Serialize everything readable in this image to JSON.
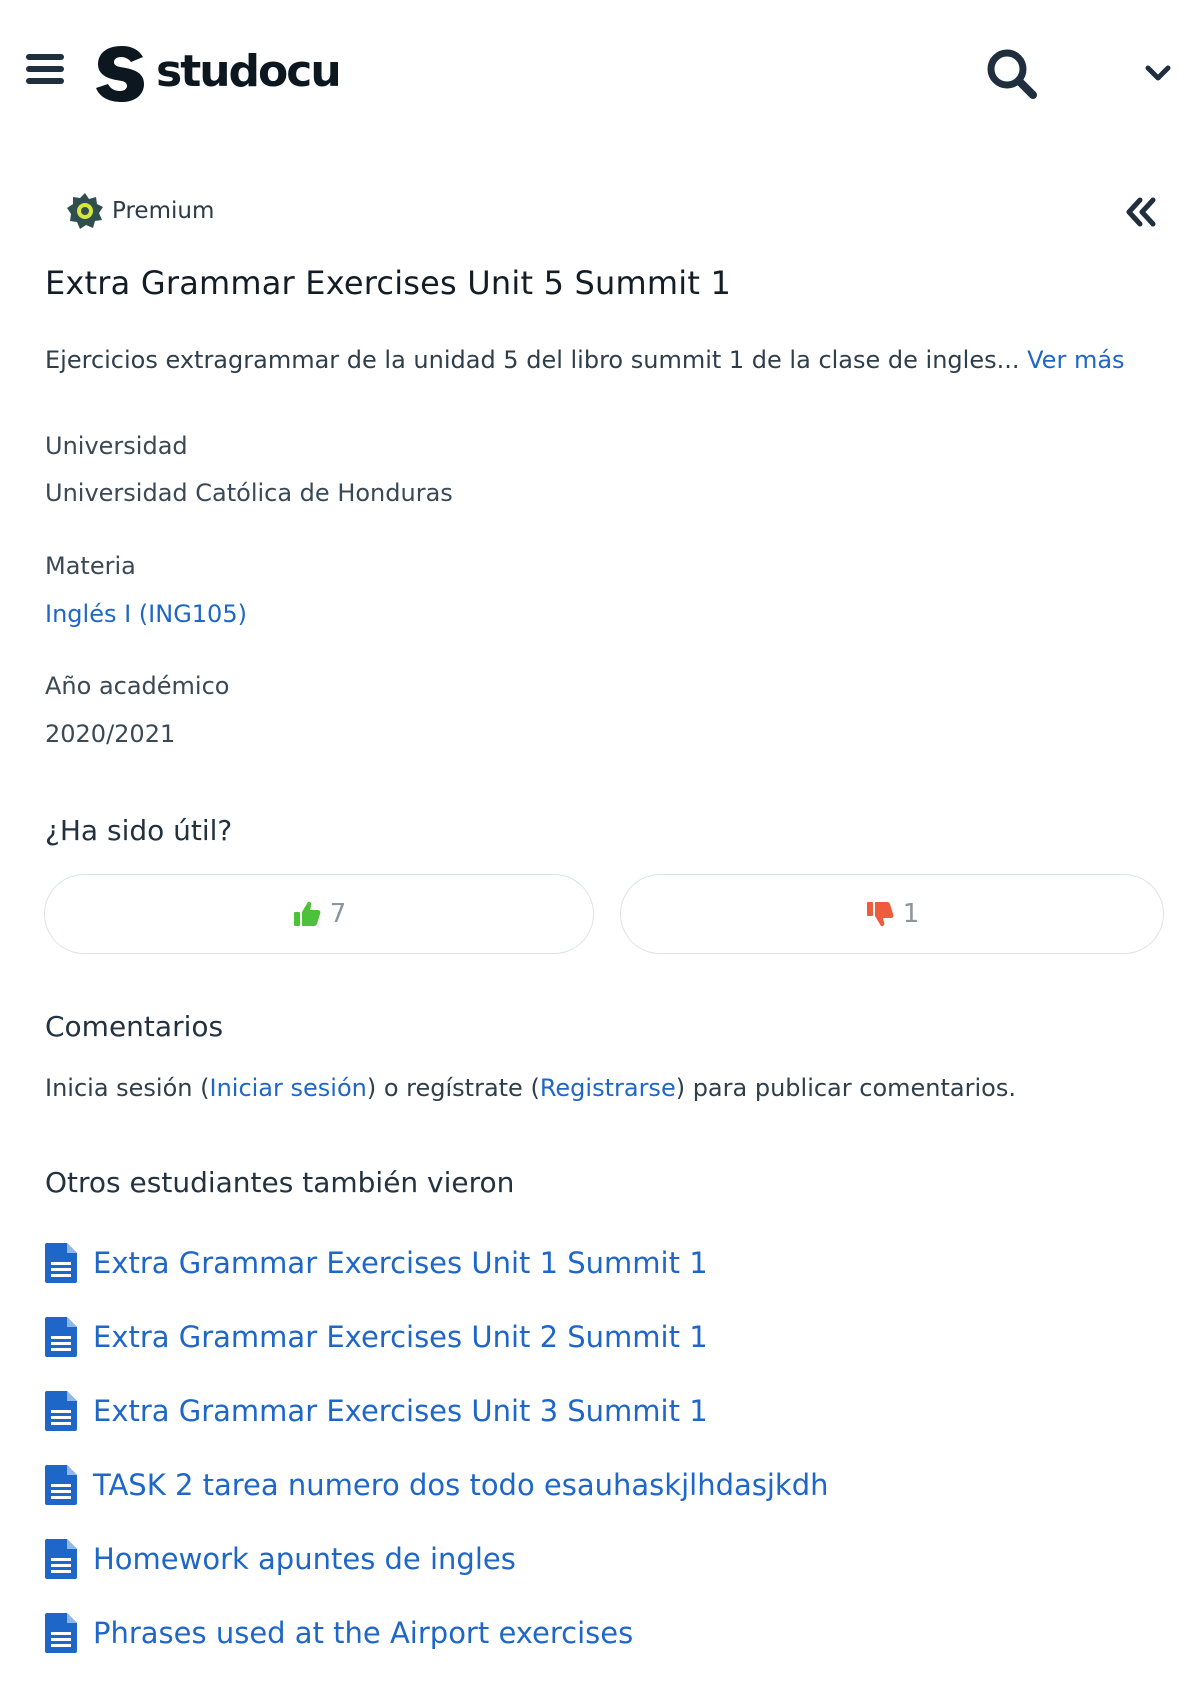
{
  "header": {
    "logo_text": "studocu",
    "menu_icon": "hamburger-icon",
    "search_icon": "search-icon",
    "account_icon": "chevron-down-icon"
  },
  "document": {
    "badge": "Premium",
    "title": "Extra Grammar Exercises Unit 5 Summit 1",
    "description": "Ejercicios extragrammar de la unidad 5 del libro summit 1 de la clase de ingles...",
    "see_more": "Ver más",
    "university_label": "Universidad",
    "university_value": "Universidad Católica de Honduras",
    "subject_label": "Materia",
    "subject_value": "Inglés I (ING105)",
    "year_label": "Año académico",
    "year_value": "2020/2021"
  },
  "feedback": {
    "heading": "¿Ha sido útil?",
    "likes": "7",
    "dislikes": "1"
  },
  "comments": {
    "heading": "Comentarios",
    "text_prefix": "Inicia sesión (",
    "login_link": "Iniciar sesión",
    "text_middle": ") o regístrate (",
    "register_link": "Registrarse",
    "text_suffix": ") para publicar comentarios."
  },
  "related": {
    "heading": "Otros estudiantes también vieron",
    "items": [
      "Extra Grammar Exercises Unit 1 Summit 1",
      "Extra Grammar Exercises Unit 2 Summit 1",
      "Extra Grammar Exercises Unit 3 Summit 1",
      "TASK 2 tarea numero dos todo esauhaskjlhdasjkdh",
      "Homework apuntes de ingles",
      "Phrases used at the Airport exercises"
    ]
  },
  "colors": {
    "link": "#1e67c8",
    "like": "#4cc23a",
    "dislike": "#ef5b3d",
    "premium_badge": "#2f4f4f"
  }
}
